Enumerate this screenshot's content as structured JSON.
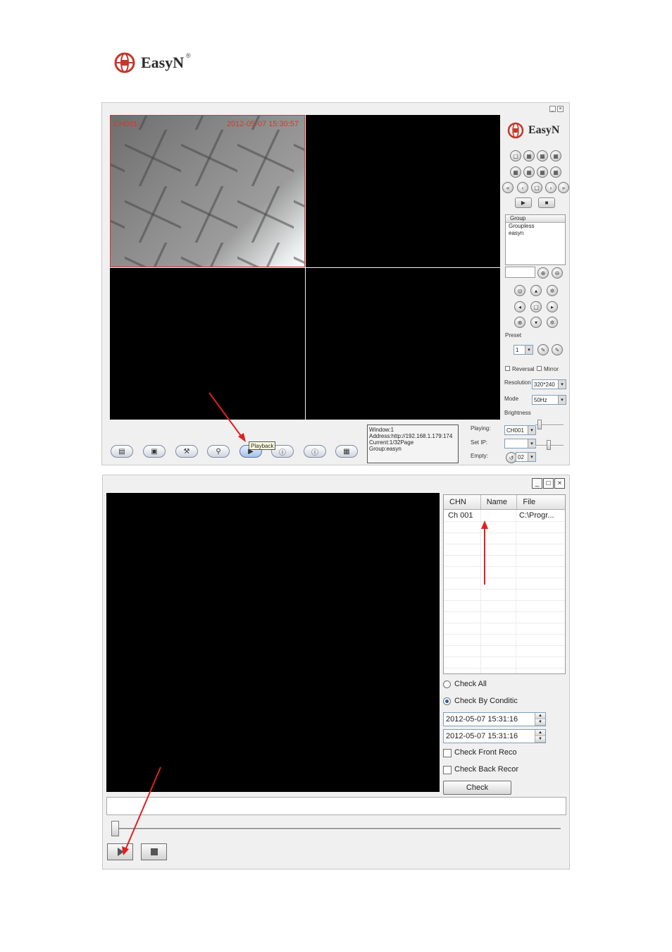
{
  "brand": {
    "name": "EasyN",
    "registered": "®"
  },
  "monitor_window": {
    "osd": {
      "channel": "CH001-",
      "timestamp": "2012-05-07 15:30:57"
    },
    "toolbar": {
      "tooltip": "Playback"
    },
    "info": {
      "window": "Window:1",
      "address": "Address:http://192.168.1.179:174",
      "current": "Current:1/32Page",
      "group": "Group:easyn"
    },
    "status": {
      "playing_label": "Playing:",
      "playing_value": "CH001",
      "setip_label": "Set IP:",
      "setip_value": "",
      "empty_label": "Empty:",
      "empty_value": "02"
    },
    "side": {
      "brand": "EasyN",
      "group_header": "Group",
      "groups": [
        "Groupless",
        "easyn"
      ],
      "preset_label": "Preset",
      "preset_value": "1",
      "reversal_label": "Reversal",
      "mirror_label": "Mirror",
      "resolution_label": "Resolution",
      "resolution_value": "320*240",
      "mode_label": "Mode",
      "mode_value": "50Hz",
      "brightness_label": "Brightness"
    }
  },
  "playback_window": {
    "columns": [
      "CHN",
      "Name",
      "File"
    ],
    "rows": [
      {
        "chn": "Ch 001",
        "name": "",
        "file": "C:\\Progr..."
      }
    ],
    "check_all_label": "Check All",
    "check_by_condition_label": "Check By Conditic",
    "start_time": "2012-05-07 15:31:16",
    "end_time": "2012-05-07 15:31:16",
    "check_front_label": "Check Front Reco",
    "check_back_label": "Check Back Recor",
    "check_button": "Check"
  },
  "colors": {
    "annotation": "#e02020",
    "osd": "#e53030"
  }
}
